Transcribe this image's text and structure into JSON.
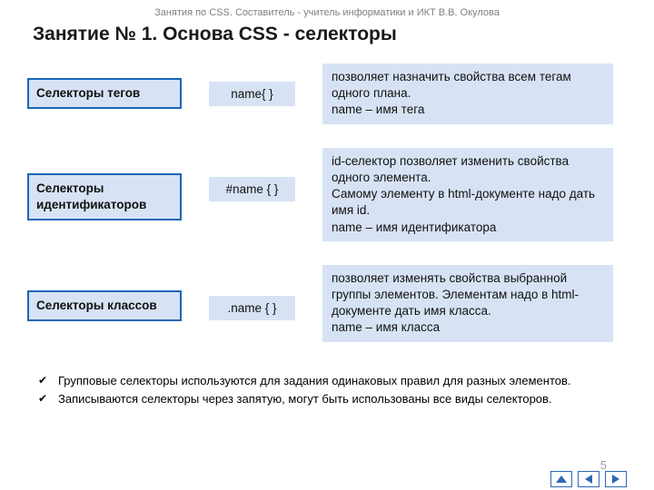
{
  "header_note": "Занятия по CSS. Составитель - учитель информатики и ИКТ В.В. Окулова",
  "title": "Занятие № 1. Основа CSS - селекторы",
  "rows": [
    {
      "label": "Селекторы тегов",
      "code": "name{  }",
      "desc": "позволяет назначить свойства всем тегам одного плана.\nname – имя тега"
    },
    {
      "label": "Селекторы идентификаторов",
      "code": "#name {  }",
      "desc": "id-селектор позволяет изменить свойства одного элемента.\nСамому элементу в html-документе надо дать имя id.\nname – имя идентификатора"
    },
    {
      "label": "Селекторы классов",
      "code": ".name {  }",
      "desc": "позволяет изменять свойства выбранной группы элементов. Элементам надо в html-документе дать имя класса.\nname – имя класса"
    }
  ],
  "footer_items": [
    "Групповые селекторы используются для задания одинаковых правил для разных элементов.",
    "Записываются селекторы через запятую, могут быть использованы все виды селекторов."
  ],
  "page_number": "5"
}
